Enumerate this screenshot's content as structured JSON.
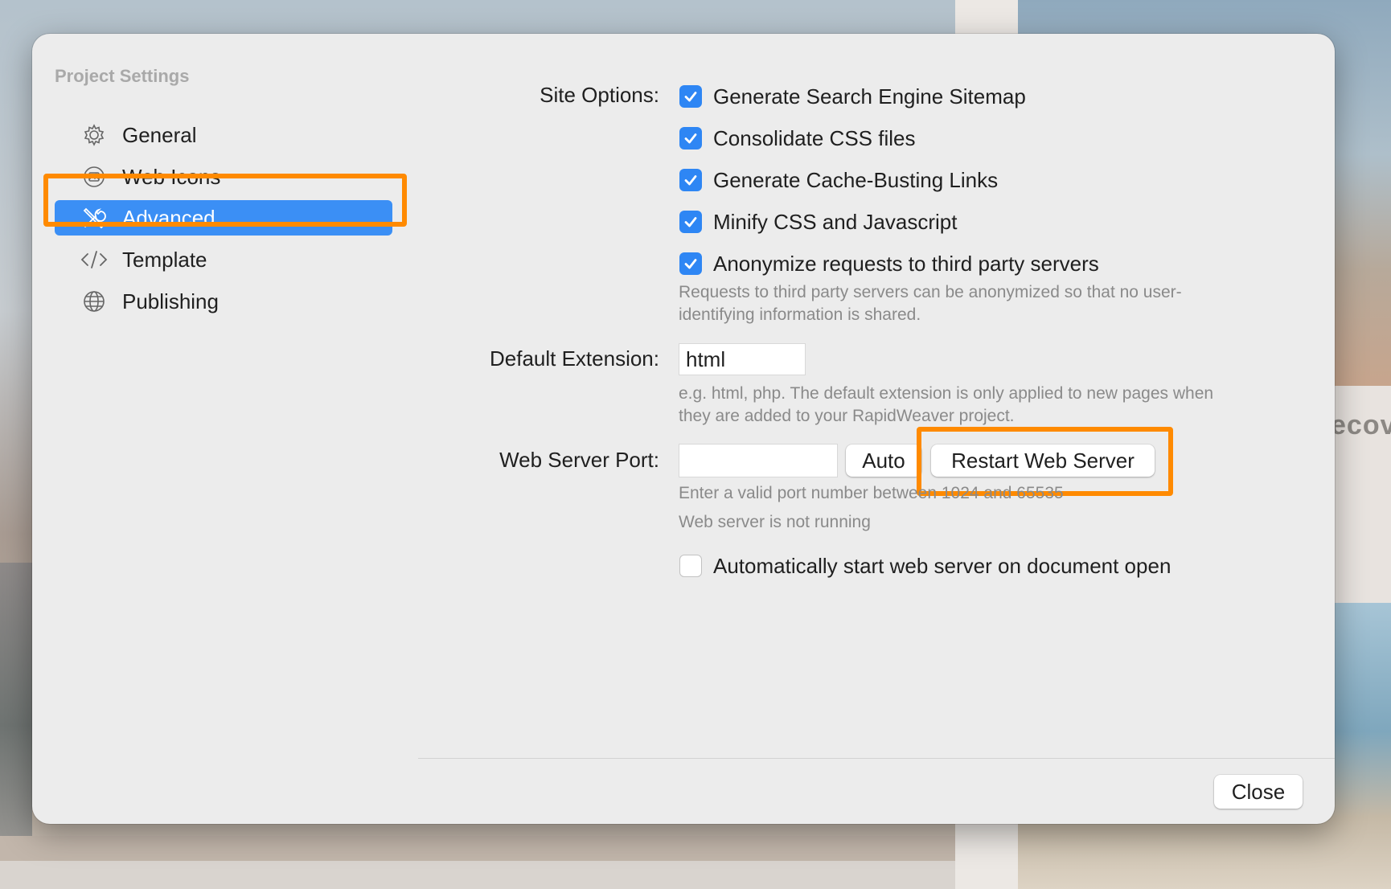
{
  "background": {
    "partial_text": "ecov"
  },
  "sidebar": {
    "title": "Project Settings",
    "items": [
      {
        "label": "General",
        "icon": "gear-icon"
      },
      {
        "label": "Web Icons",
        "icon": "image-icon"
      },
      {
        "label": "Advanced",
        "icon": "tools-icon",
        "selected": true
      },
      {
        "label": "Template",
        "icon": "code-icon"
      },
      {
        "label": "Publishing",
        "icon": "globe-icon"
      }
    ]
  },
  "site_options": {
    "label": "Site Options:",
    "options": [
      {
        "label": "Generate Search Engine Sitemap",
        "checked": true
      },
      {
        "label": "Consolidate CSS files",
        "checked": true
      },
      {
        "label": "Generate Cache-Busting Links",
        "checked": true
      },
      {
        "label": "Minify CSS and Javascript",
        "checked": true
      },
      {
        "label": "Anonymize requests to third party servers",
        "checked": true
      }
    ],
    "anonymize_hint_line1": "Requests to third party servers can be anonymized so that no user-",
    "anonymize_hint_line2": "identifying information is shared."
  },
  "default_extension": {
    "label": "Default Extension:",
    "value": "html",
    "hint_line1": "e.g. html, php. The default extension is only applied to new pages when",
    "hint_line2": "they are added to your RapidWeaver project."
  },
  "web_server": {
    "label": "Web Server Port:",
    "port_value": "",
    "auto_label": "Auto",
    "restart_label": "Restart Web Server",
    "port_hint": "Enter a valid port number between 1024 and 65535",
    "status": "Web server is not running",
    "auto_start_label": "Automatically start web server on document open",
    "auto_start_checked": false
  },
  "footer": {
    "close_label": "Close"
  },
  "colors": {
    "accent": "#3b8ff5",
    "checkbox": "#2e86f4",
    "highlight": "#ff8a00"
  }
}
